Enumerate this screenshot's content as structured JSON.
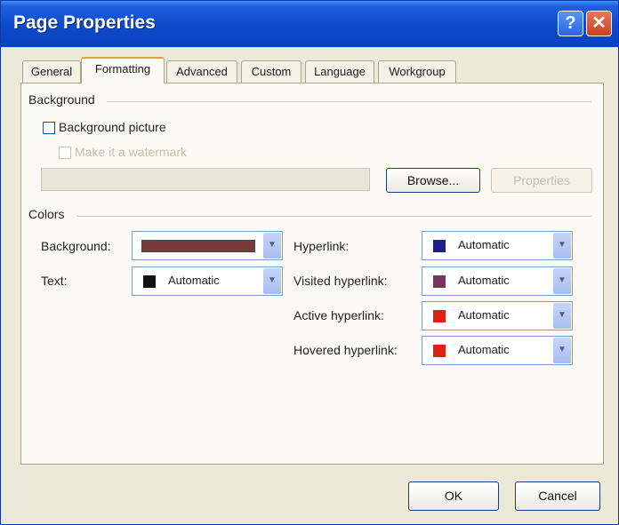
{
  "window": {
    "title": "Page Properties"
  },
  "tabs": [
    {
      "label": "General"
    },
    {
      "label": "Formatting"
    },
    {
      "label": "Advanced"
    },
    {
      "label": "Custom"
    },
    {
      "label": "Language"
    },
    {
      "label": "Workgroup"
    }
  ],
  "background": {
    "group_label": "Background",
    "picture_label": "Background picture",
    "watermark_label": "Make it a watermark",
    "browse_label": "Browse...",
    "properties_label": "Properties"
  },
  "colors": {
    "group_label": "Colors",
    "background_label": "Background:",
    "background_color": "#7a3a3a",
    "text_label": "Text:",
    "text_value": "Automatic",
    "text_color": "#111111",
    "hyperlink_label": "Hyperlink:",
    "hyperlink_value": "Automatic",
    "hyperlink_color": "#1e1e8e",
    "visited_label": "Visited hyperlink:",
    "visited_value": "Automatic",
    "visited_color": "#7a3560",
    "active_label": "Active hyperlink:",
    "active_value": "Automatic",
    "active_color": "#e02010",
    "hovered_label": "Hovered hyperlink:",
    "hovered_value": "Automatic",
    "hovered_color": "#e02010"
  },
  "footer": {
    "ok_label": "OK",
    "cancel_label": "Cancel"
  },
  "icons": {
    "help": "help-icon",
    "close": "close-icon",
    "dropdown": "chevron-down-icon"
  }
}
